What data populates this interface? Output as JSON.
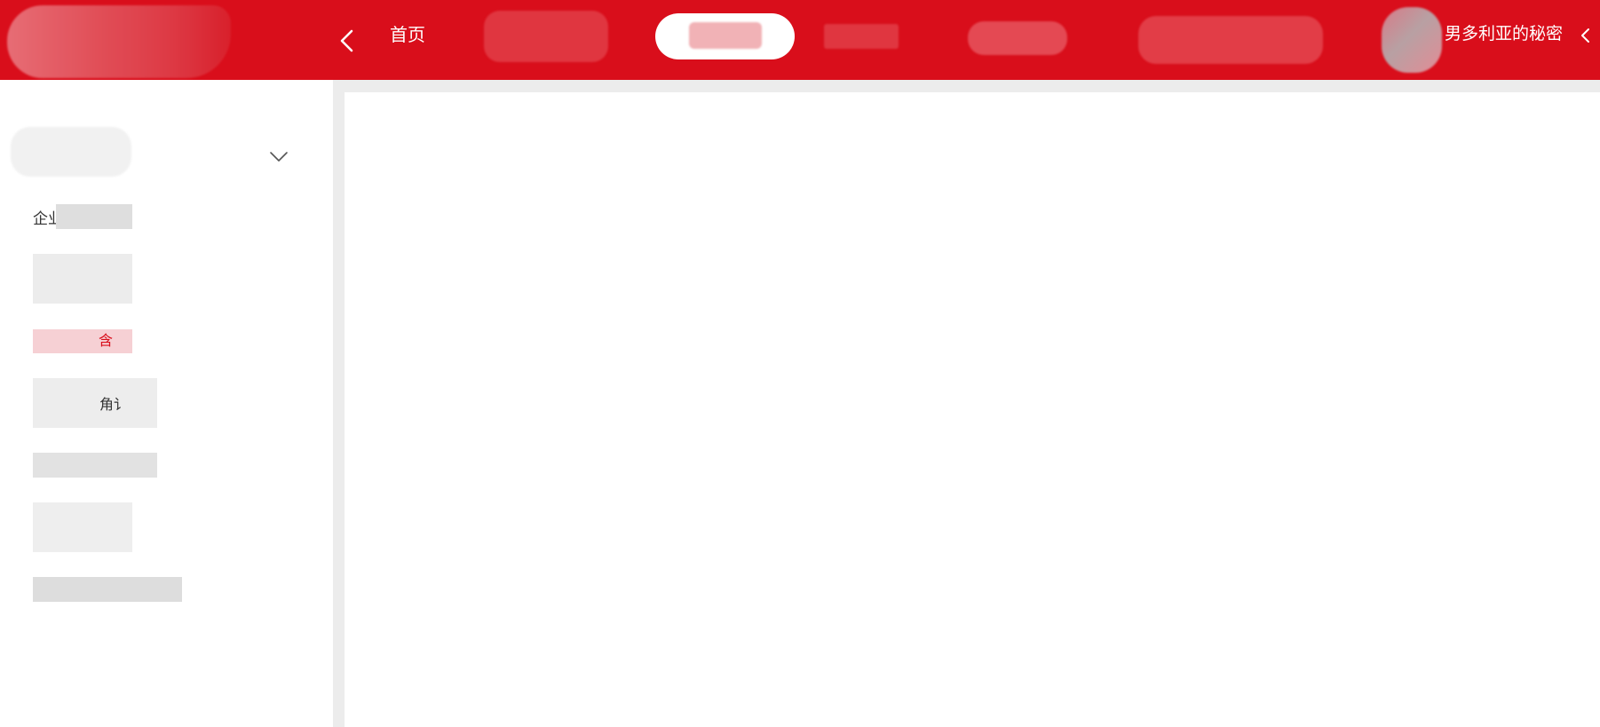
{
  "colors": {
    "brand_red": "#d90e1b",
    "active_tab_bg": "#ffffff",
    "selected_item_text": "#d90e1b",
    "divider": "#ececec"
  },
  "header": {
    "home_label": "首页",
    "username": "男多利亚的秘密",
    "back_icon": "chevron-left-icon",
    "user_menu_icon": "chevron-left-icon"
  },
  "sidebar": {
    "group_toggle_icon": "chevron-down-icon",
    "items": [
      {
        "label": "企业"
      },
      {
        "label": ""
      },
      {
        "label": "含"
      },
      {
        "label": "角讠"
      },
      {
        "label": ""
      },
      {
        "label": ""
      },
      {
        "label": ""
      }
    ]
  }
}
